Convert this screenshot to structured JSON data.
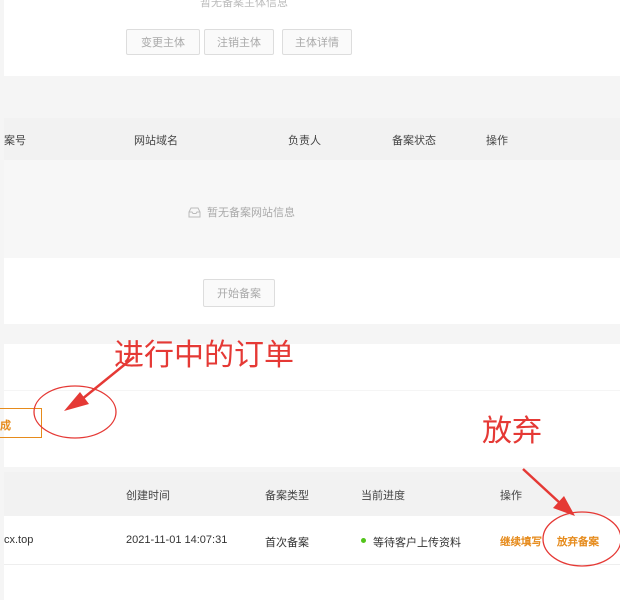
{
  "subject": {
    "empty_text": "暂无备案主体信息",
    "buttons": {
      "change": "变更主体",
      "cancel": "注销主体",
      "detail": "主体详情"
    }
  },
  "website_table": {
    "headers": {
      "record_no": "案号",
      "domain": "网站域名",
      "owner": "负责人",
      "status": "备案状态",
      "action": "操作"
    },
    "empty_text": "暂无备案网站信息",
    "start_button": "开始备案"
  },
  "orders": {
    "tab_partial": "成",
    "headers": {
      "created": "创建时间",
      "type": "备案类型",
      "progress": "当前进度",
      "action": "操作"
    },
    "rows": [
      {
        "domain": "cx.top",
        "created": "2021-11-01 14:07:31",
        "type": "首次备案",
        "progress": "等待客户上传资料",
        "continue": "继续填写",
        "abandon": "放弃备案"
      }
    ]
  },
  "annotations": {
    "in_progress": "进行中的订单",
    "abandon": "放弃"
  },
  "colors": {
    "accent_orange": "#e68b1c",
    "annotation_red": "#e53935",
    "status_green": "#52c41a"
  }
}
